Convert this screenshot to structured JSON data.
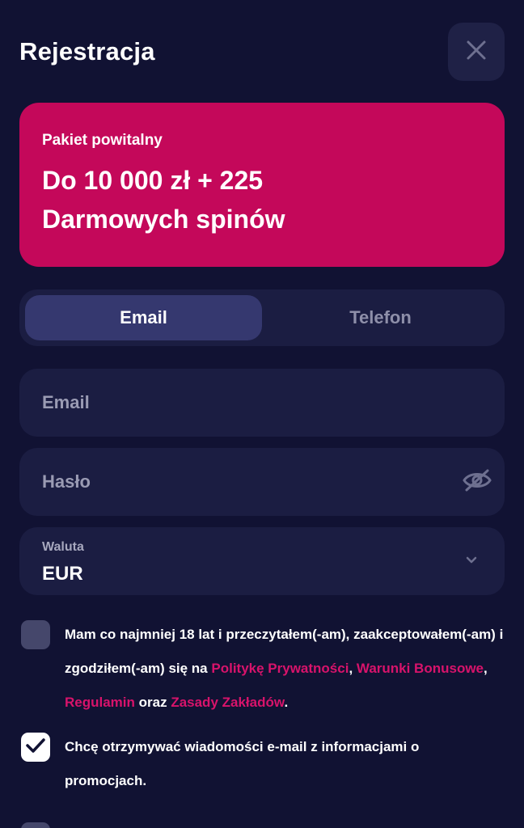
{
  "header": {
    "title": "Rejestracja",
    "close_icon": "close-icon"
  },
  "promo": {
    "subtitle": "Pakiet powitalny",
    "headline": "Do 10 000 zł + 225 Darmowych spinów",
    "background": "#c4085a"
  },
  "tabs": [
    {
      "label": "Email",
      "active": true
    },
    {
      "label": "Telefon",
      "active": false
    }
  ],
  "form": {
    "email": {
      "value": "",
      "placeholder": "Email"
    },
    "password": {
      "value": "",
      "placeholder": "Hasło",
      "toggle_icon": "eye-off-icon"
    },
    "currency": {
      "label": "Waluta",
      "value": "EUR",
      "icon": "chevron-down-icon"
    }
  },
  "consents": {
    "terms": {
      "checked": false,
      "text_start": "Mam co najmniej 18 lat i przeczytałem(-am), zaakceptowałem(-am) i zgodziłem(-am) się na ",
      "link_privacy": "Politykę Prywatności",
      "sep1": ", ",
      "link_bonus": "Warunki Bonusowe",
      "sep2": ", ",
      "link_rules": "Regulamin",
      "sep3": " oraz ",
      "link_betting": "Zasady Zakładów",
      "text_end": "."
    },
    "marketing": {
      "checked": true,
      "text": "Chcę otrzymywać wiadomości e-mail z informacjami o promocjach."
    }
  },
  "colors": {
    "background": "#111233",
    "surface": "#1b1d42",
    "tab_active": "#35386f",
    "accent": "#c4085a",
    "link": "#d8136b"
  }
}
